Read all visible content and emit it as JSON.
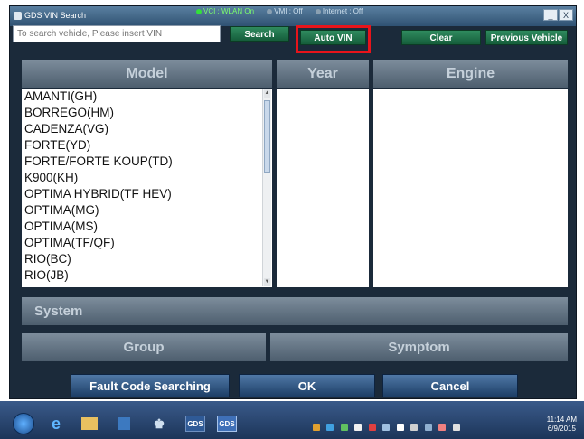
{
  "window": {
    "title": "GDS VIN Search",
    "status": {
      "vci": "VCI : WLAN On",
      "vmi": "VMI : Off",
      "internet": "Internet : Off"
    },
    "controls": {
      "minimize": "_",
      "close": "X"
    }
  },
  "search": {
    "placeholder": "To search vehicle, Please insert VIN",
    "search_label": "Search",
    "auto_vin_label": "Auto VIN",
    "clear_label": "Clear",
    "previous_vehicle_label": "Previous Vehicle"
  },
  "columns": {
    "model": "Model",
    "year": "Year",
    "engine": "Engine"
  },
  "models": [
    "AMANTI(GH)",
    "BORREGO(HM)",
    "CADENZA(VG)",
    "FORTE(YD)",
    "FORTE/FORTE KOUP(TD)",
    "K900(KH)",
    "OPTIMA HYBRID(TF HEV)",
    "OPTIMA(MG)",
    "OPTIMA(MS)",
    "OPTIMA(TF/QF)",
    "RIO(BC)",
    "RIO(JB)"
  ],
  "sections": {
    "system": "System",
    "group": "Group",
    "symptom": "Symptom"
  },
  "actions": {
    "fault_code": "Fault Code Searching",
    "ok": "OK",
    "cancel": "Cancel"
  },
  "taskbar": {
    "app1": "GDS",
    "app2": "GDS",
    "time": "11:14 AM",
    "date": "6/9/2015"
  },
  "colors": {
    "highlight": "#e8141b",
    "green_button": "#1f7a4c",
    "header": "#6b7b8b"
  }
}
